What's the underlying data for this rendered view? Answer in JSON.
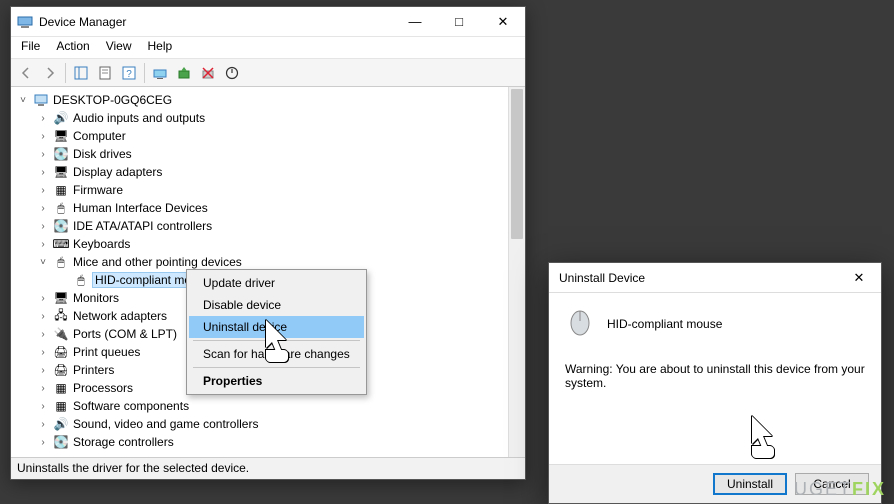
{
  "main_window": {
    "title": "Device Manager",
    "menus": [
      "File",
      "Action",
      "View",
      "Help"
    ],
    "root": "DESKTOP-0GQ6CEG",
    "categories": [
      {
        "label": "Audio inputs and outputs",
        "expanded": false
      },
      {
        "label": "Computer",
        "expanded": false
      },
      {
        "label": "Disk drives",
        "expanded": false
      },
      {
        "label": "Display adapters",
        "expanded": false
      },
      {
        "label": "Firmware",
        "expanded": false
      },
      {
        "label": "Human Interface Devices",
        "expanded": false
      },
      {
        "label": "IDE ATA/ATAPI controllers",
        "expanded": false
      },
      {
        "label": "Keyboards",
        "expanded": false
      },
      {
        "label": "Mice and other pointing devices",
        "expanded": true,
        "children": [
          {
            "label": "HID-compliant mouse",
            "selected": true
          }
        ]
      },
      {
        "label": "Monitors",
        "expanded": false
      },
      {
        "label": "Network adapters",
        "expanded": false
      },
      {
        "label": "Ports (COM & LPT)",
        "expanded": false
      },
      {
        "label": "Print queues",
        "expanded": false
      },
      {
        "label": "Printers",
        "expanded": false
      },
      {
        "label": "Processors",
        "expanded": false
      },
      {
        "label": "Software components",
        "expanded": false
      },
      {
        "label": "Sound, video and game controllers",
        "expanded": false
      },
      {
        "label": "Storage controllers",
        "expanded": false
      }
    ],
    "statusbar": "Uninstalls the driver for the selected device."
  },
  "context_menu": {
    "items": [
      {
        "label": "Update driver",
        "type": "item"
      },
      {
        "label": "Disable device",
        "type": "item"
      },
      {
        "label": "Uninstall device",
        "type": "item",
        "highlighted": true
      },
      {
        "type": "sep"
      },
      {
        "label": "Scan for hardware changes",
        "type": "item"
      },
      {
        "type": "sep"
      },
      {
        "label": "Properties",
        "type": "item",
        "bold": true
      }
    ]
  },
  "dialog": {
    "title": "Uninstall Device",
    "device": "HID-compliant mouse",
    "warning": "Warning: You are about to uninstall this device from your system.",
    "buttons": {
      "primary": "Uninstall",
      "secondary": "Cancel"
    }
  },
  "watermark": {
    "pre": "UGET",
    "accent": "FIX"
  }
}
